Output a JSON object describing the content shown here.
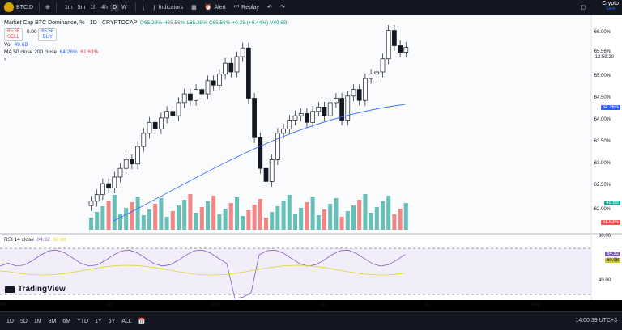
{
  "toolbar": {
    "symbol": "BTC.D",
    "intervals": [
      "1m",
      "5m",
      "1h",
      "4h",
      "D",
      "W"
    ],
    "active_interval": "D",
    "indicators_label": "Indicators",
    "alert_label": "Alert",
    "replay_label": "Replay",
    "crypto_label": "Crypto",
    "crypto_sub": "Save"
  },
  "legend": {
    "title": "Market Cap BTC Dominance, %  · 1D · CRYPTOCAP",
    "ohlc": "O65.28% H65.56% L65.28% C65.56% +0.28 (+0.44%) V49.6B",
    "sell_price": "65.56",
    "sell_label": "SELL",
    "spread": "0.00",
    "buy_price": "65.56",
    "buy_label": "BUY",
    "vol_label": "Vol",
    "vol_value": "49.6B",
    "ma_label": "MA 50 close 200 close",
    "ma_50": "64.26%",
    "ma_200": "61.63%",
    "rsi_label": "RSI 14 close",
    "rsi_value": "64.32",
    "rsi_ma": "60.98"
  },
  "price_axis": {
    "ticks": [
      "66.00%",
      "65.56%",
      "65.00%",
      "64.50%",
      "64.00%",
      "63.50%",
      "63.00%",
      "62.50%",
      "62.00%"
    ],
    "countdown": "12:59:20",
    "ma50_pill": "64.26%",
    "vol_pill": "49.6B",
    "ma200_pill": "61.63%"
  },
  "rsi_axis": {
    "ticks": [
      "80.00",
      "64.32",
      "60.98",
      "40.00"
    ]
  },
  "time_axis": {
    "ticks": [
      "Mar",
      "Apr",
      "May",
      "Jun",
      "Jul",
      "Aug"
    ]
  },
  "bottombar": {
    "timeframes": [
      "1D",
      "5D",
      "1M",
      "3M",
      "6M",
      "YTD",
      "1Y",
      "5Y",
      "ALL"
    ],
    "clock": "14:00:39 UTC+3"
  },
  "watermark": "TradingView",
  "colors": {
    "up": "#26a69a",
    "down": "#ef5350",
    "ma50": "#2962ff",
    "rsi": "#7e57c2",
    "rsi_ma": "#d7d52c"
  },
  "chart_data": {
    "type": "candlestick",
    "title": "Market Cap BTC Dominance, %",
    "candles_close": [
      62.05,
      62.2,
      62.45,
      62.35,
      62.6,
      62.8,
      63.0,
      62.9,
      63.3,
      63.6,
      63.85,
      63.7,
      63.95,
      64.1,
      64.0,
      64.3,
      64.5,
      64.35,
      64.6,
      64.5,
      64.8,
      64.7,
      64.95,
      65.2,
      65.0,
      65.35,
      65.55,
      64.4,
      63.5,
      62.8,
      62.5,
      63.0,
      63.6,
      63.7,
      63.9,
      64.0,
      64.05,
      63.85,
      64.1,
      64.2,
      64.0,
      64.3,
      64.4,
      63.9,
      64.45,
      64.6,
      64.35,
      64.85,
      64.95,
      65.0,
      65.3,
      65.95,
      65.6,
      65.45,
      65.56
    ],
    "ma50": {
      "from": 61.6,
      "to": 64.26
    },
    "ylim": [
      61.4,
      66.2
    ],
    "rsi_last": 64.32,
    "rsi_ma_last": 60.98
  }
}
